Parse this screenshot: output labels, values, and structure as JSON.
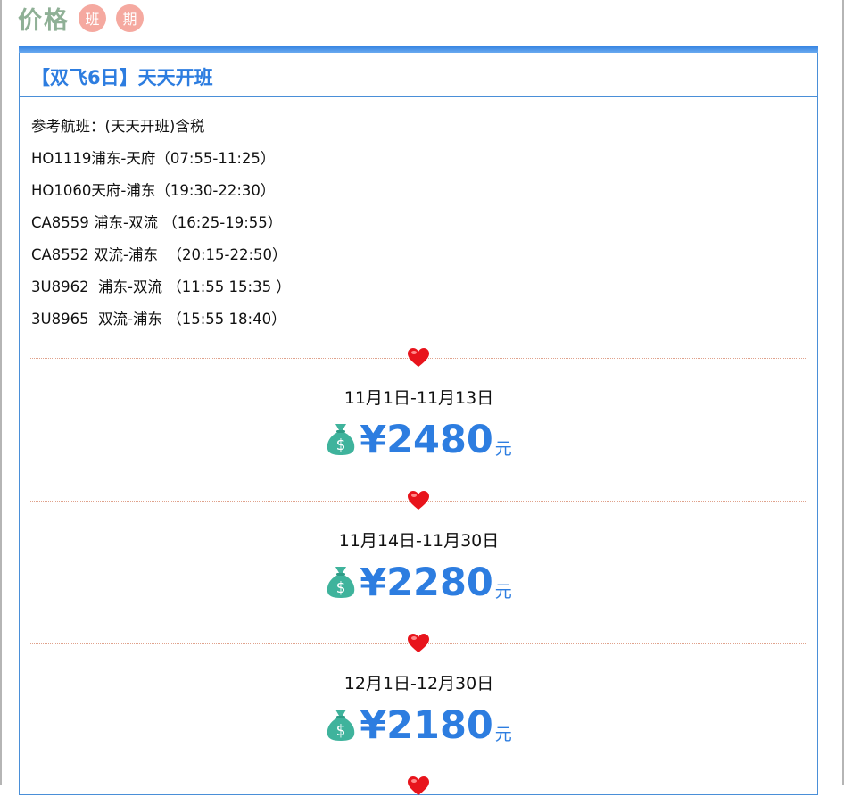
{
  "page": {
    "title": "价格",
    "tags": [
      "班",
      "期"
    ]
  },
  "card": {
    "title": "【双飞6日】天天开班",
    "routes": [
      "参考航班：(天天开班)含税",
      "HO1119浦东-天府（07:55-11:25）",
      "HO1060天府-浦东（19:30-22:30）",
      "CA8559 浦东-双流 （16:25-19:55）",
      "CA8552 双流-浦东  （20:15-22:50）",
      "3U8962  浦东-双流 （11:55 15:35 ）",
      "3U8965  双流-浦东 （15:55 18:40）"
    ],
    "prices": [
      {
        "date": "11月1日-11月13日",
        "amount": "¥2480",
        "unit": "元"
      },
      {
        "date": "11月14日-11月30日",
        "amount": "¥2280",
        "unit": "元"
      },
      {
        "date": "12月1日-12月30日",
        "amount": "¥2180",
        "unit": "元"
      }
    ]
  },
  "icons": {
    "divider": "heart-icon",
    "price": "money-bag-icon"
  },
  "colors": {
    "accent": "#2d7de0",
    "title_green": "#8fb096",
    "tag_pink": "#f5a9a0",
    "heart_red": "#e8141c",
    "bag_teal": "#3fb39c"
  }
}
